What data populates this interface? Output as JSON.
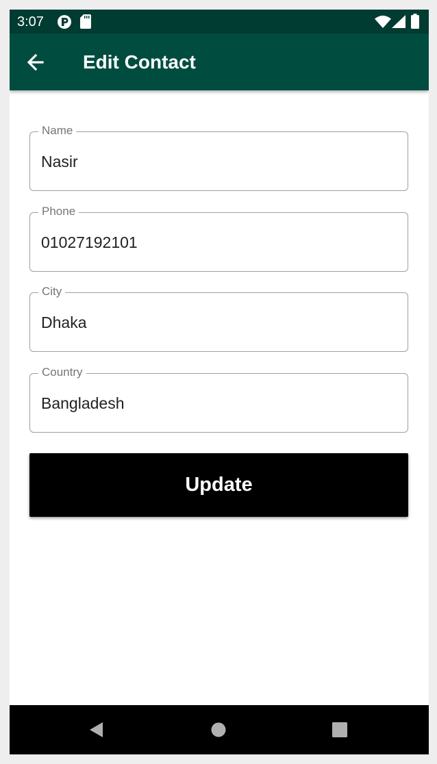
{
  "status_bar": {
    "time": "3:07",
    "icons": [
      "notification-p-icon",
      "sd-card-icon",
      "wifi-icon",
      "signal-icon",
      "battery-icon"
    ]
  },
  "app_bar": {
    "title": "Edit Contact",
    "back_icon": "arrow-back-icon",
    "background": "#004d40"
  },
  "form": {
    "fields": [
      {
        "label": "Name",
        "value": "Nasir"
      },
      {
        "label": "Phone",
        "value": "01027192101"
      },
      {
        "label": "City",
        "value": "Dhaka"
      },
      {
        "label": "Country",
        "value": "Bangladesh"
      }
    ],
    "update_label": "Update"
  },
  "nav_bar": {
    "items": [
      "back-triangle-icon",
      "home-circle-icon",
      "recents-square-icon"
    ]
  },
  "colors": {
    "status_bar": "#003c31",
    "app_bar": "#004d40",
    "button": "#000000",
    "field_border": "#9e9e9e"
  }
}
